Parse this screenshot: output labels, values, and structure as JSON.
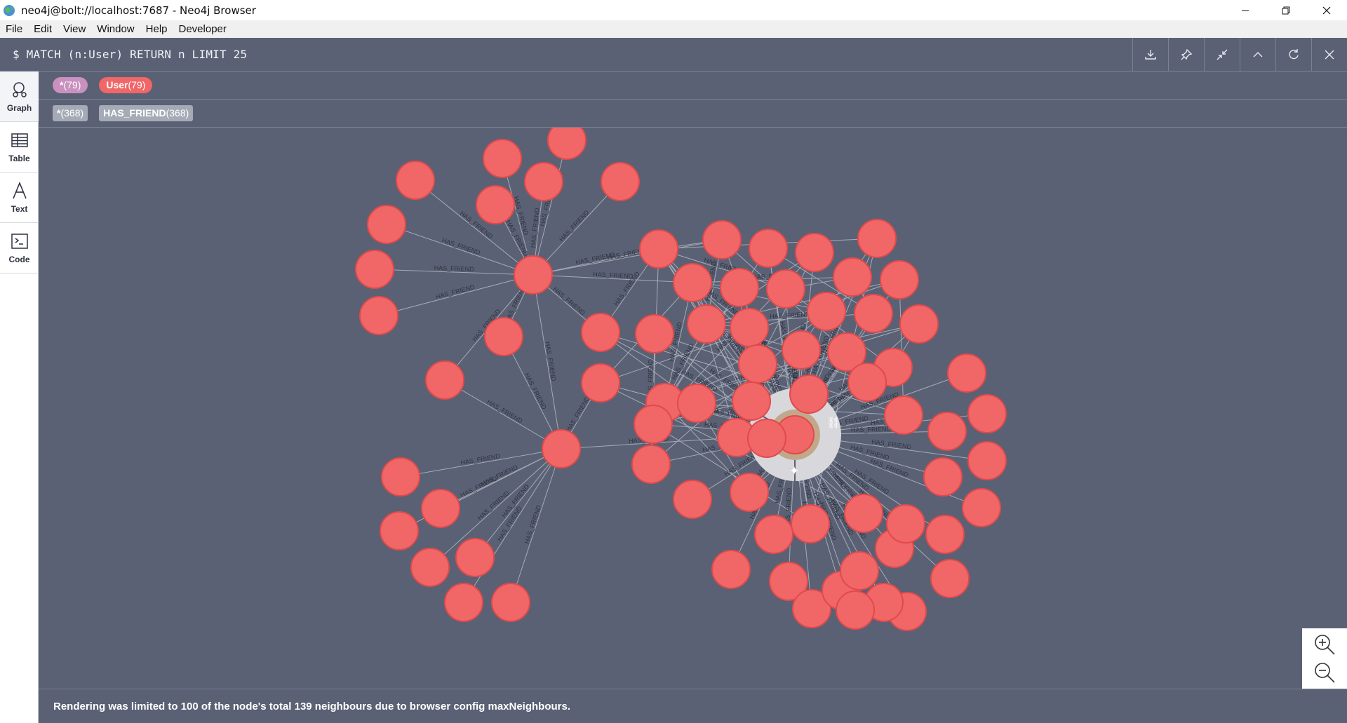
{
  "window": {
    "title": "neo4j@bolt://localhost:7687 - Neo4j Browser",
    "icon": "neo4j-globe-icon"
  },
  "menu": [
    "File",
    "Edit",
    "View",
    "Window",
    "Help",
    "Developer"
  ],
  "query": {
    "text": "$ MATCH (n:User) RETURN n LIMIT 25",
    "actions": [
      "download-icon",
      "pin-icon",
      "collapse-icon",
      "chevron-up-icon",
      "rerun-icon",
      "close-icon"
    ]
  },
  "sidebar": {
    "items": [
      {
        "label": "Graph",
        "icon": "graph-icon",
        "active": true
      },
      {
        "label": "Table",
        "icon": "table-icon",
        "active": false
      },
      {
        "label": "Text",
        "icon": "text-icon",
        "active": false
      },
      {
        "label": "Code",
        "icon": "code-icon",
        "active": false
      }
    ]
  },
  "legend": {
    "nodes": [
      {
        "label": "*",
        "count": "(79)",
        "color": "#c990c0"
      },
      {
        "label": "User",
        "count": "(79)",
        "color": "#f16667"
      }
    ],
    "relationships": [
      {
        "label": "*",
        "count": "(368)",
        "color": "#a5abb6"
      },
      {
        "label": "HAS_FRIEND",
        "count": "(368)",
        "color": "#a5abb6"
      }
    ]
  },
  "graph": {
    "node_color": "#f16667",
    "node_stroke": "#e04a4b",
    "edge_color": "#a5abb6",
    "edge_label": "HAS_FRIEND",
    "background": "#5a6174",
    "selected_node": {
      "ring_color": "#d8d8dc",
      "halo_color": "#c2a88a"
    }
  },
  "zoom": {
    "in_icon": "zoom-in-icon",
    "out_icon": "zoom-out-icon"
  },
  "status": {
    "message": "Rendering was limited to 100 of the node's total 139 neighbours due to browser config maxNeighbours."
  }
}
